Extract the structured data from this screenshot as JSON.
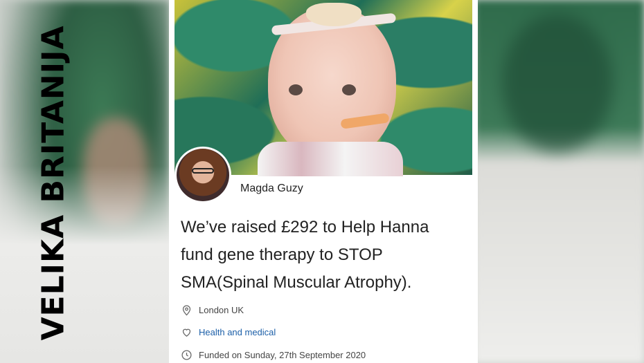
{
  "overlay": {
    "vertical_label": "VELIKA BRITANIJA"
  },
  "card": {
    "author_name": "Magda Guzy",
    "headline": "We’ve raised £292 to Help Hanna fund gene therapy to STOP SMA(Spinal Muscular Atrophy).",
    "location": "London UK",
    "category": "Health and medical",
    "funded": "Funded on Sunday, 27th September 2020",
    "icons": {
      "location": "location-pin-icon",
      "category": "heart-icon",
      "funded": "clock-icon"
    },
    "colors": {
      "link": "#1c5fa8",
      "text": "#222222",
      "muted": "#444444"
    }
  }
}
